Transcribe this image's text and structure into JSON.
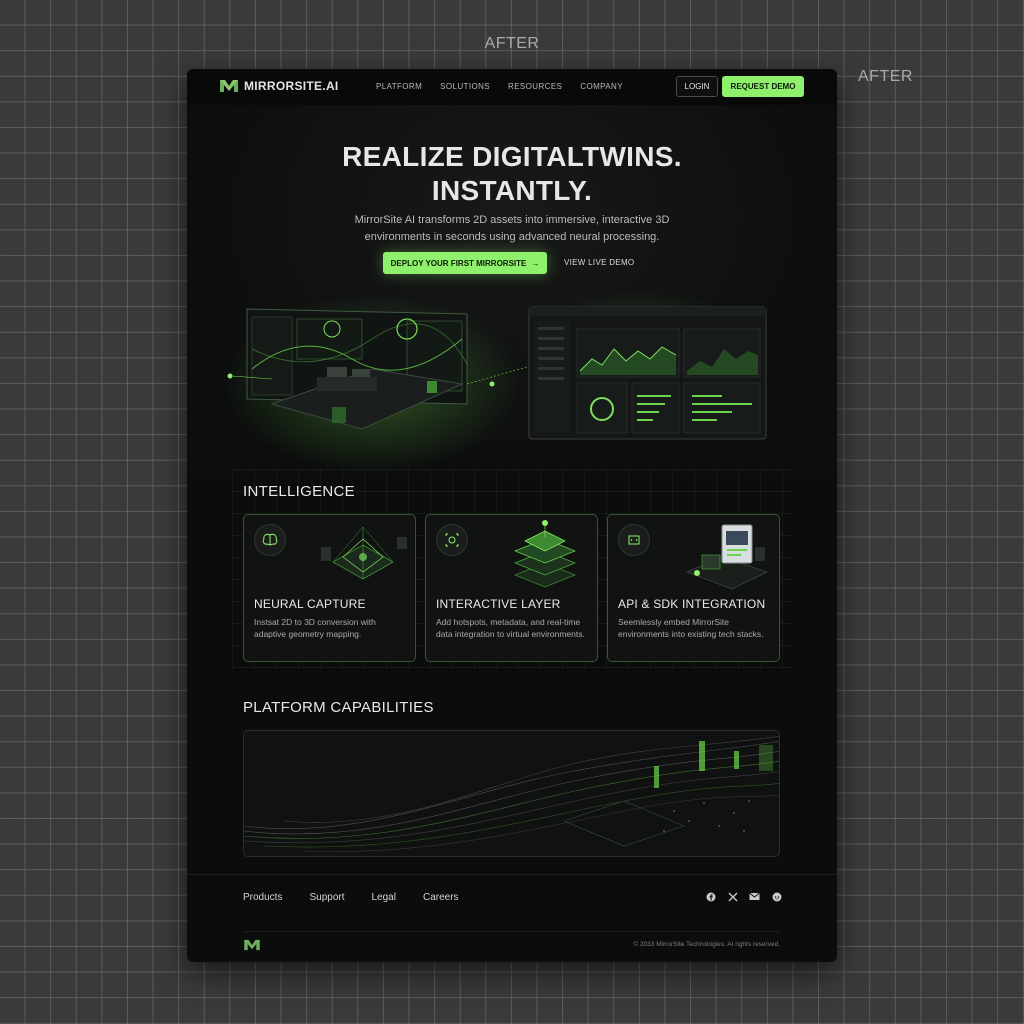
{
  "captions": {
    "top": "AFTER",
    "right": "AFTER"
  },
  "nav": {
    "brand": "MIRRORSITE.AI",
    "links": [
      "PLATFORM",
      "SOLUTIONS",
      "RESOURCES",
      "COMPANY"
    ],
    "login": "LOGIN",
    "request_demo": "REQUEST DEMO"
  },
  "hero": {
    "title_line1": "REALIZE DIGITALTWINS.",
    "title_line2": "INSTANTLY.",
    "subtitle": "MirrorSite AI transforms 2D assets into immersive, interactive 3D environments in seconds using advanced neural processing.",
    "cta_primary": "DEPLOY YOUR FIRST MIRRORSITE",
    "cta_primary_arrow": "→",
    "cta_secondary": "VIEW LIVE DEMO"
  },
  "intelligence": {
    "title": "INTELLIGENCE",
    "cards": [
      {
        "title": "NEURAL CAPTURE",
        "desc": "Instsat 2D to 3D conversion with adaptive geometry mapping.",
        "icon": "brain-icon"
      },
      {
        "title": "INTERACTIVE LAYER",
        "desc": "Add hotspots, metadata, and real-time data integration to virtual environments.",
        "icon": "layers-target-icon"
      },
      {
        "title": "API & SDK INTEGRATION",
        "desc": "Seemlessly embed MirrorSite environments into existing tech stacks.",
        "icon": "code-chip-icon"
      }
    ]
  },
  "platform": {
    "title": "PLATFORM CAPABILITIES"
  },
  "footer": {
    "links": [
      "Products",
      "Support",
      "Legal",
      "Careers"
    ],
    "social_icons": [
      "facebook-icon",
      "x-icon",
      "mail-icon",
      "reddit-icon"
    ],
    "copyright": "© 2033 MirrorSite Technologies. AI rights reserved."
  },
  "colors": {
    "accent": "#8ff06c",
    "background": "#0b0c0c",
    "card_border": "#2f5a2f"
  }
}
